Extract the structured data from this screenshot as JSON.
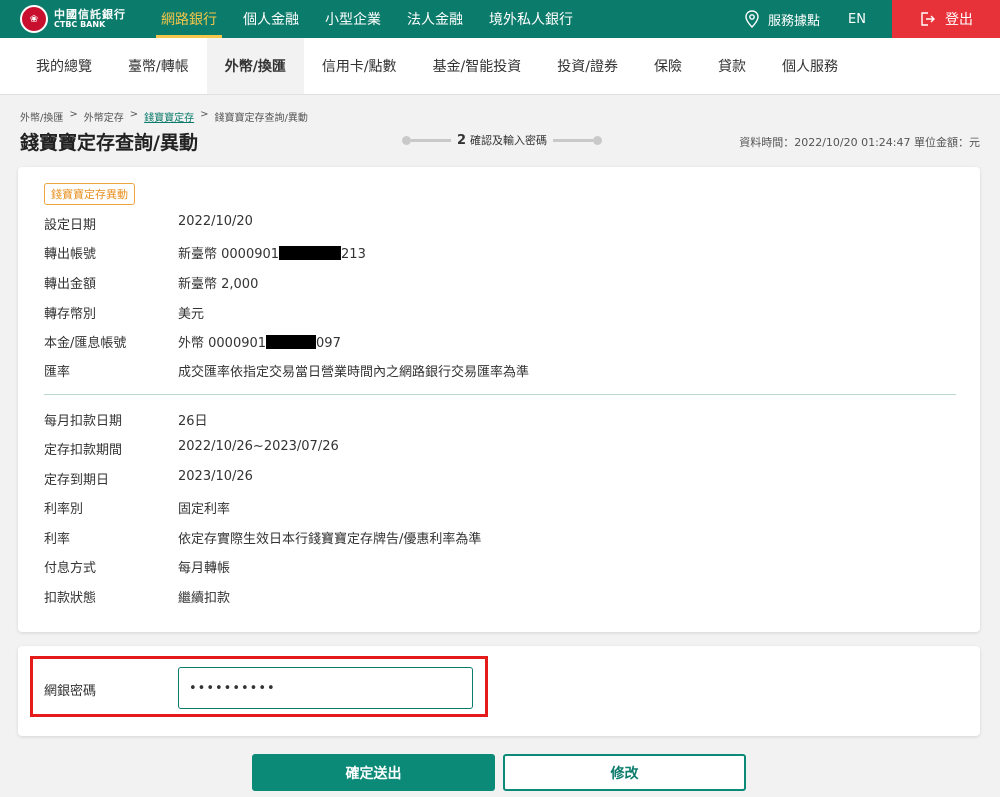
{
  "brand": {
    "zh": "中國信託銀行",
    "en": "CTBC BANK"
  },
  "topnav": [
    {
      "label": "網路銀行",
      "active": true
    },
    {
      "label": "個人金融",
      "active": false
    },
    {
      "label": "小型企業",
      "active": false
    },
    {
      "label": "法人金融",
      "active": false
    },
    {
      "label": "境外私人銀行",
      "active": false
    }
  ],
  "topright": {
    "branches": "服務據點",
    "lang": "EN",
    "logout": "登出"
  },
  "subnav": [
    {
      "label": "我的總覽",
      "active": false
    },
    {
      "label": "臺幣/轉帳",
      "active": false
    },
    {
      "label": "外幣/換匯",
      "active": true
    },
    {
      "label": "信用卡/點數",
      "active": false
    },
    {
      "label": "基金/智能投資",
      "active": false
    },
    {
      "label": "投資/證券",
      "active": false
    },
    {
      "label": "保險",
      "active": false
    },
    {
      "label": "貸款",
      "active": false
    },
    {
      "label": "個人服務",
      "active": false
    }
  ],
  "breadcrumb": {
    "c1": "外幣/換匯",
    "c2": "外幣定存",
    "c3": "錢寶寶定存",
    "c4": "錢寶寶定存查詢/異動",
    "sep": ">"
  },
  "page_title": "錢寶寶定存查詢/異動",
  "stepper": {
    "number": "2",
    "label": "確認及輸入密碼"
  },
  "data_time": "資料時間：2022/10/20 01:24:47 單位金額：元",
  "detail": {
    "tag": "錢寶寶定存異動",
    "rows": [
      {
        "label": "設定日期",
        "value": "2022/10/20"
      },
      {
        "label": "轉出帳號",
        "value_pre": "新臺幣 0000901",
        "value_post": "213"
      },
      {
        "label": "轉出金額",
        "value": "新臺幣 2,000"
      },
      {
        "label": "轉存幣別",
        "value": "美元"
      },
      {
        "label": "本金/匯息帳號",
        "value_pre": "外幣 0000901",
        "value_post": "097"
      },
      {
        "label": "匯率",
        "value": "成交匯率依指定交易當日營業時間內之網路銀行交易匯率為準"
      },
      {
        "label": "每月扣款日期",
        "value": "26日"
      },
      {
        "label": "定存扣款期間",
        "value": "2022/10/26~2023/07/26"
      },
      {
        "label": "定存到期日",
        "value": "2023/10/26"
      },
      {
        "label": "利率別",
        "value": "固定利率"
      },
      {
        "label": "利率",
        "value": "依定存實際生效日本行錢寶寶定存牌告/優惠利率為準"
      },
      {
        "label": "付息方式",
        "value": "每月轉帳"
      },
      {
        "label": "扣款狀態",
        "value": "繼續扣款"
      }
    ]
  },
  "password": {
    "label": "網銀密碼",
    "value": "••••••••••"
  },
  "buttons": {
    "submit": "確定送出",
    "edit": "修改"
  },
  "colors": {
    "brand_green": "#0b7b6b",
    "active_yellow": "#f4c64a",
    "logout_red": "#e8323a",
    "tag_orange": "#e89122",
    "highlight_red": "#e51a1a"
  }
}
